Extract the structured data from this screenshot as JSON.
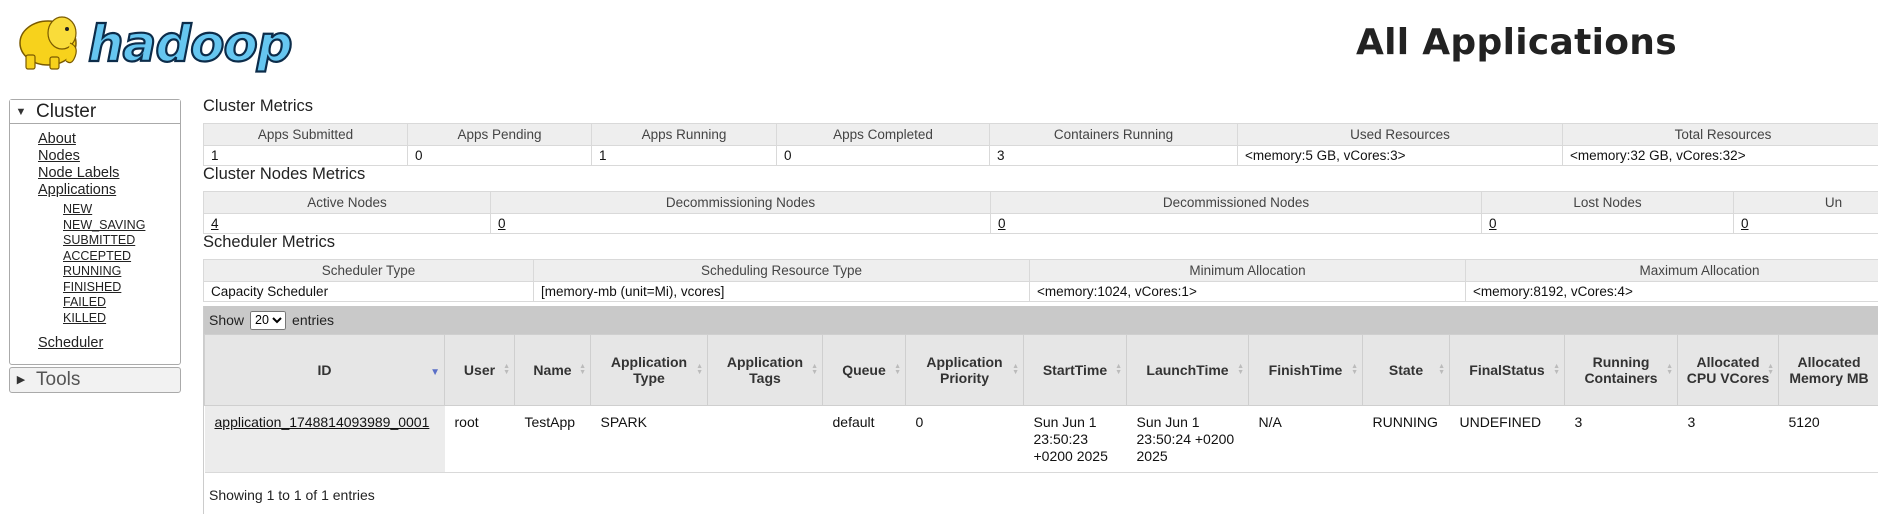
{
  "header": {
    "logo_text": "hadoop",
    "title": "All Applications"
  },
  "sidebar": {
    "cluster": {
      "label": "Cluster",
      "items": [
        "About",
        "Nodes",
        "Node Labels",
        "Applications"
      ],
      "app_states": [
        "NEW",
        "NEW_SAVING",
        "SUBMITTED",
        "ACCEPTED",
        "RUNNING",
        "FINISHED",
        "FAILED",
        "KILLED"
      ],
      "scheduler": "Scheduler"
    },
    "tools": {
      "label": "Tools"
    }
  },
  "cluster_metrics": {
    "title": "Cluster Metrics",
    "headers": [
      "Apps Submitted",
      "Apps Pending",
      "Apps Running",
      "Apps Completed",
      "Containers Running",
      "Used Resources",
      "Total Resources"
    ],
    "values": [
      "1",
      "0",
      "1",
      "0",
      "3",
      "<memory:5 GB, vCores:3>",
      "<memory:32 GB, vCores:32>"
    ]
  },
  "node_metrics": {
    "title": "Cluster Nodes Metrics",
    "headers": [
      "Active Nodes",
      "Decommissioning Nodes",
      "Decommissioned Nodes",
      "Lost Nodes",
      "Un"
    ],
    "values": [
      "4",
      "0",
      "0",
      "0",
      "0"
    ]
  },
  "scheduler_metrics": {
    "title": "Scheduler Metrics",
    "headers": [
      "Scheduler Type",
      "Scheduling Resource Type",
      "Minimum Allocation",
      "Maximum Allocation"
    ],
    "values": [
      "Capacity Scheduler",
      "[memory-mb (unit=Mi), vcores]",
      "<memory:1024, vCores:1>",
      "<memory:8192, vCores:4>"
    ]
  },
  "apps_table": {
    "show_label": "Show",
    "page_size": "20",
    "entries_label": "entries",
    "columns": [
      "ID",
      "User",
      "Name",
      "Application Type",
      "Application Tags",
      "Queue",
      "Application Priority",
      "StartTime",
      "LaunchTime",
      "FinishTime",
      "State",
      "FinalStatus",
      "Running Containers",
      "Allocated CPU VCores",
      "Allocated Memory MB"
    ],
    "rows": [
      {
        "id": "application_1748814093989_0001",
        "user": "root",
        "name": "TestApp",
        "type": "SPARK",
        "tags": "",
        "queue": "default",
        "priority": "0",
        "start": "Sun Jun 1 23:50:23 +0200 2025",
        "launch": "Sun Jun 1 23:50:24 +0200 2025",
        "finish": "N/A",
        "state": "RUNNING",
        "final_status": "UNDEFINED",
        "running_containers": "3",
        "vcores": "3",
        "memory": "5120"
      }
    ],
    "info": "Showing 1 to 1 of 1 entries"
  }
}
